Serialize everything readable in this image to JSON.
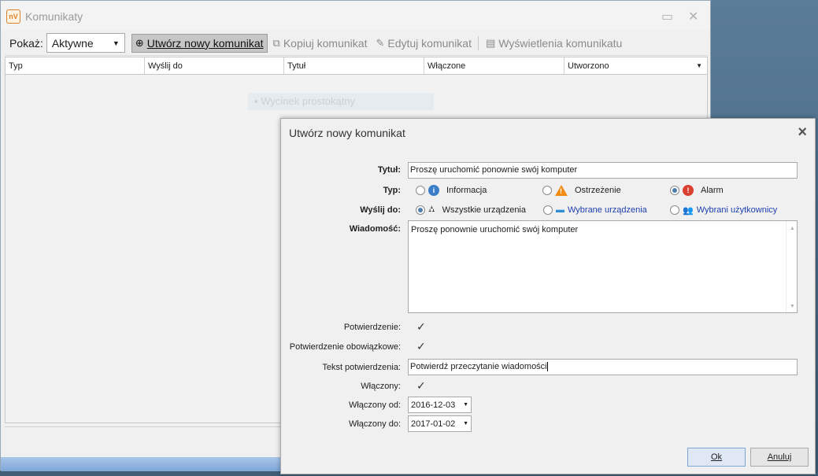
{
  "window": {
    "title": "Komunikaty",
    "icon_text": "nV"
  },
  "toolbar": {
    "show_label": "Pokaż:",
    "show_value": "Aktywne",
    "create_button": "Utwórz nowy komunikat",
    "copy_button": "Kopiuj komunikat",
    "edit_button": "Edytuj komunikat",
    "views_button": "Wyświetlenia komunikatu"
  },
  "grid": {
    "columns": [
      "Typ",
      "Wyślij do",
      "Tytuł",
      "Włączone",
      "Utworzono"
    ],
    "ghost_hint": "Wycinek prostokątny"
  },
  "dialog": {
    "title": "Utwórz nowy komunikat",
    "title_label": "Tytuł:",
    "title_value": "Proszę uruchomić ponownie swój komputer",
    "type_label": "Typ:",
    "type_options": [
      {
        "label": "Informacja",
        "selected": false
      },
      {
        "label": "Ostrzeżenie",
        "selected": false
      },
      {
        "label": "Alarm",
        "selected": true
      }
    ],
    "send_label": "Wyślij do:",
    "send_options": [
      {
        "label": "Wszystkie urządzenia",
        "selected": true
      },
      {
        "label": "Wybrane urządzenia",
        "selected": false
      },
      {
        "label": "Wybrani użytkownicy",
        "selected": false
      }
    ],
    "message_label": "Wiadomość:",
    "message_value": "Proszę ponownie uruchomić swój komputer",
    "confirm_label": "Potwierdzenie:",
    "confirm_required_label": "Potwierdzenie obowiązkowe:",
    "confirm_text_label": "Tekst potwierdzenia:",
    "confirm_text_value": "Potwierdź przeczytanie wiadomości",
    "enabled_label": "Włączony:",
    "enabled_from_label": "Włączony od:",
    "enabled_from_value": "2016-12-03",
    "enabled_to_label": "Włączony do:",
    "enabled_to_value": "2017-01-02",
    "ok_button": "Ok",
    "cancel_button": "Anuluj"
  },
  "colors": {
    "accent": "#4f7fae",
    "link_blue": "#1c3fae",
    "alarm_red": "#d9402f",
    "warning_orange": "#f08c16",
    "info_blue": "#3b7ec8"
  }
}
